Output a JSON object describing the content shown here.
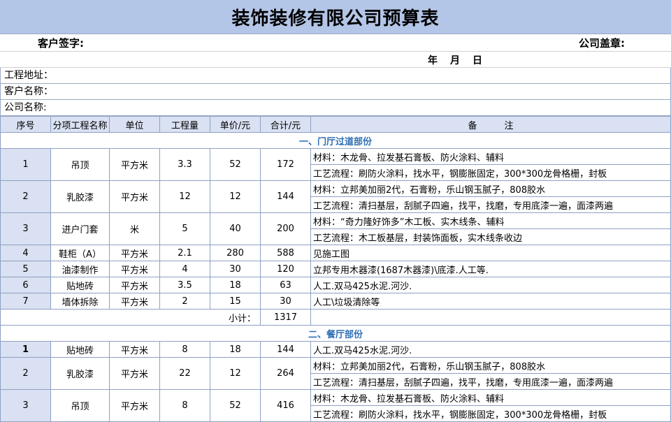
{
  "title": "装饰装修有限公司预算表",
  "customer_sign_label": "客户签字:",
  "company_seal_label": "公司盖章:",
  "date_label": "年　月　日",
  "project_address_label": "工程地址：",
  "customer_name_label": "客户名称：",
  "company_name_label": "公司名称:",
  "headers": [
    "序号",
    "分项工程名称",
    "单位",
    "工程量",
    "单价/元",
    "合计/元",
    "备　　　注"
  ],
  "sections": [
    {
      "title": "一、门厅过道部份",
      "items": [
        {
          "no": "1",
          "name": "吊顶",
          "unit": "平方米",
          "qty": "3.3",
          "price": "52",
          "total": "172",
          "notes": [
            "材料：木龙骨、拉发基石膏板、防火涂料、辅料",
            "工艺流程：刷防火涂料，找水平，钢膨胀固定，300*300龙骨格栅，封板"
          ]
        },
        {
          "no": "2",
          "name": "乳胶漆",
          "unit": "平方米",
          "qty": "12",
          "price": "12",
          "total": "144",
          "notes": [
            "材料：立邦美加丽2代，石膏粉，乐山钢玉腻子，808胶水",
            "工艺流程：清扫基层，刮腻子四遍，找平，找磨，专用底漆一遍，面漆两遍"
          ]
        },
        {
          "no": "3",
          "name": "进户门套",
          "unit": "米",
          "qty": "5",
          "price": "40",
          "total": "200",
          "notes": [
            "材料：“奇力隆好饰多”木工板、实木线条、辅料",
            "工艺流程：木工板基层，封装饰面板，实木线条收边"
          ]
        },
        {
          "no": "4",
          "name": "鞋柜（A）",
          "unit": "平方米",
          "qty": "2.1",
          "price": "280",
          "total": "588",
          "notes": [
            "见施工图"
          ]
        },
        {
          "no": "5",
          "name": "油漆制作",
          "unit": "平方米",
          "qty": "4",
          "price": "30",
          "total": "120",
          "notes": [
            "立邦专用木器漆(1687木器漆)\\底漆.人工等."
          ]
        },
        {
          "no": "6",
          "name": "贴地砖",
          "unit": "平方米",
          "qty": "3.5",
          "price": "18",
          "total": "63",
          "notes": [
            "人工.双马425水泥.河沙."
          ]
        },
        {
          "no": "7",
          "name": "墙体拆除",
          "unit": "平方米",
          "qty": "2",
          "price": "15",
          "total": "30",
          "notes": [
            "人工\\垃圾清除等"
          ]
        }
      ],
      "subtotal_label": "小计：",
      "subtotal": "1317"
    },
    {
      "title": "二、餐厅部份",
      "items": [
        {
          "no": "1",
          "name": "贴地砖",
          "unit": "平方米",
          "qty": "8",
          "price": "18",
          "total": "144",
          "notes": [
            "人工.双马425水泥.河沙."
          ]
        },
        {
          "no": "2",
          "name": "乳胶漆",
          "unit": "平方米",
          "qty": "22",
          "price": "12",
          "total": "264",
          "notes": [
            "材料：立邦美加丽2代，石膏粉，乐山钢玉腻子，808胶水",
            "工艺流程：清扫基层，刮腻子四遍，找平，找磨，专用底漆一遍，面漆两遍"
          ]
        },
        {
          "no": "3",
          "name": "吊顶",
          "unit": "平方米",
          "qty": "8",
          "price": "52",
          "total": "416",
          "notes": [
            "材料：木龙骨、拉发基石膏板、防火涂料、辅料",
            "工艺流程：刷防火涂料，找水平，钢膨胀固定，300*300龙骨格栅，封板"
          ]
        }
      ]
    }
  ]
}
